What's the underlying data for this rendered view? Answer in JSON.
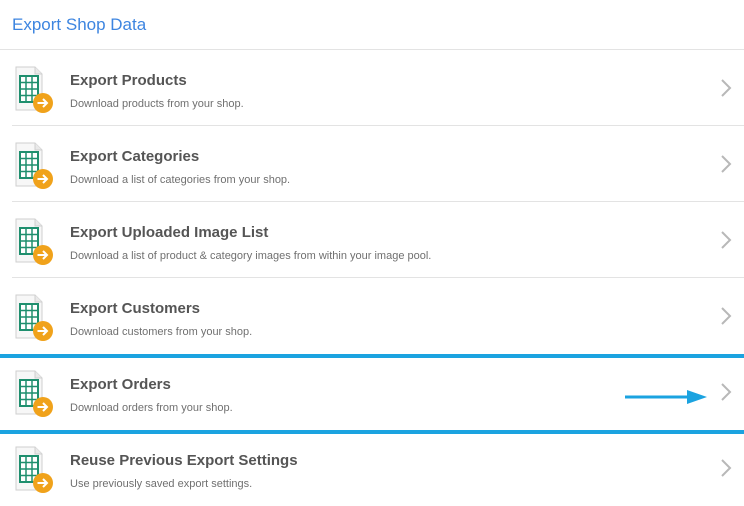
{
  "header": {
    "title": "Export Shop Data"
  },
  "items": [
    {
      "title": "Export Products",
      "description": "Download products from your shop."
    },
    {
      "title": "Export Categories",
      "description": "Download a list of categories from your shop."
    },
    {
      "title": "Export Uploaded Image List",
      "description": "Download a list of product & category images from within your image pool."
    },
    {
      "title": "Export Customers",
      "description": "Download customers from your shop."
    },
    {
      "title": "Export Orders",
      "description": "Download orders from your shop."
    },
    {
      "title": "Reuse Previous Export Settings",
      "description": "Use previously saved export settings."
    }
  ],
  "highlighted_item": "Export Orders",
  "icons": {
    "item_icon": "spreadsheet-export-icon",
    "row_arrow": "chevron-right-icon",
    "annotation": "arrow-right-icon"
  },
  "colors": {
    "title": "#3d85e0",
    "highlight": "#1ba3e0",
    "icon_grid": "#1f8f6e",
    "icon_badge": "#f0a21b"
  }
}
